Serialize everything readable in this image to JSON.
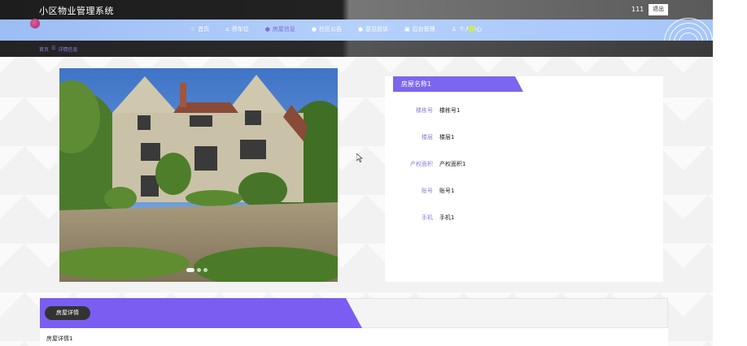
{
  "header": {
    "app_title": "小区物业管理系统",
    "username": "111",
    "logout_label": "退出"
  },
  "nav": {
    "items": [
      {
        "label": "首页",
        "icon": "star-icon",
        "glyph": "☆"
      },
      {
        "label": "停车位",
        "icon": "home-icon",
        "glyph": "⌂"
      },
      {
        "label": "房屋信息",
        "icon": "circle-icon",
        "glyph": "●",
        "active": true
      },
      {
        "label": "社区公告",
        "icon": "circle-icon",
        "glyph": "●"
      },
      {
        "label": "意见投诉",
        "icon": "circle-icon",
        "glyph": "●"
      },
      {
        "label": "后台管理",
        "icon": "building-icon",
        "glyph": "▣"
      },
      {
        "label": "个人中心",
        "icon": "user-icon",
        "glyph": "♙"
      }
    ]
  },
  "breadcrumb": {
    "home": "首页",
    "separator": "☰",
    "current": "详情信息"
  },
  "gallery": {
    "slides": 3,
    "active_slide": 1
  },
  "house": {
    "name": "房屋名称1",
    "fields": [
      {
        "label": "楼栋号",
        "value": "楼栋号1"
      },
      {
        "label": "楼层",
        "value": "楼层1"
      },
      {
        "label": "产权面积",
        "value": "产权面积1"
      },
      {
        "label": "账号",
        "value": "账号1"
      },
      {
        "label": "手机",
        "value": "手机1"
      }
    ]
  },
  "details": {
    "tab_label": "房屋详情",
    "content": "房屋详情1"
  },
  "colors": {
    "accent": "#7b66ee",
    "nav_bg": "#a7c6f9",
    "active_nav": "#7b6fd6"
  }
}
